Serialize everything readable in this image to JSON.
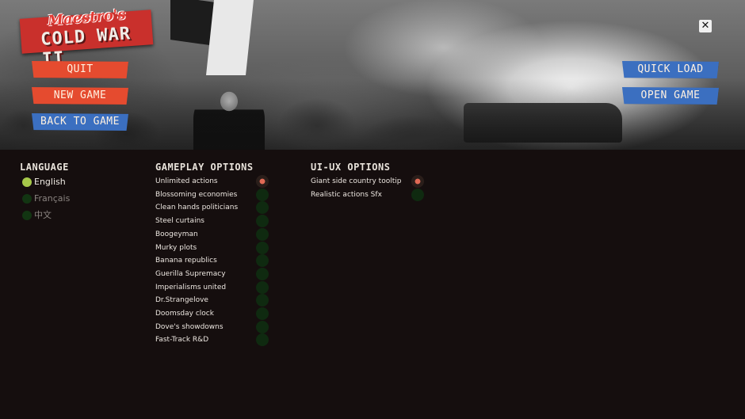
{
  "logo": {
    "script": "Maestro's",
    "title": "COLD WAR II"
  },
  "menu": {
    "quit": "QUIT",
    "new_game": "NEW GAME",
    "back_to_game": "BACK TO GAME",
    "quick_load": "QUICK LOAD",
    "open_game_folder": "OPEN GAME FOLDER",
    "close": "✕"
  },
  "colors": {
    "red_button": "#e54b2f",
    "blue_button": "#3b6fc0",
    "background": "#150e0e",
    "toggle_on": "#e06a55",
    "toggle_off": "#0f2a10"
  },
  "language": {
    "title": "LANGUAGE",
    "items": [
      {
        "label": "English",
        "selected": true
      },
      {
        "label": "Français",
        "selected": false
      },
      {
        "label": "中文",
        "selected": false
      }
    ]
  },
  "gameplay": {
    "title": "GAMEPLAY OPTIONS",
    "items": [
      {
        "label": "Unlimited actions",
        "on": true
      },
      {
        "label": "Blossoming economies",
        "on": false
      },
      {
        "label": "Clean hands politicians",
        "on": false
      },
      {
        "label": "Steel curtains",
        "on": false
      },
      {
        "label": "Boogeyman",
        "on": false
      },
      {
        "label": "Murky plots",
        "on": false
      },
      {
        "label": "Banana republics",
        "on": false
      },
      {
        "label": "Guerilla Supremacy",
        "on": false
      },
      {
        "label": "Imperialisms united",
        "on": false
      },
      {
        "label": "Dr.Strangelove",
        "on": false
      },
      {
        "label": "Doomsday clock",
        "on": false
      },
      {
        "label": "Dove's showdowns",
        "on": false
      },
      {
        "label": "Fast-Track R&D",
        "on": false
      }
    ]
  },
  "uiux": {
    "title": "UI-UX OPTIONS",
    "items": [
      {
        "label": "Giant side country tooltip",
        "on": true
      },
      {
        "label": "Realistic actions Sfx",
        "on": false
      }
    ]
  }
}
